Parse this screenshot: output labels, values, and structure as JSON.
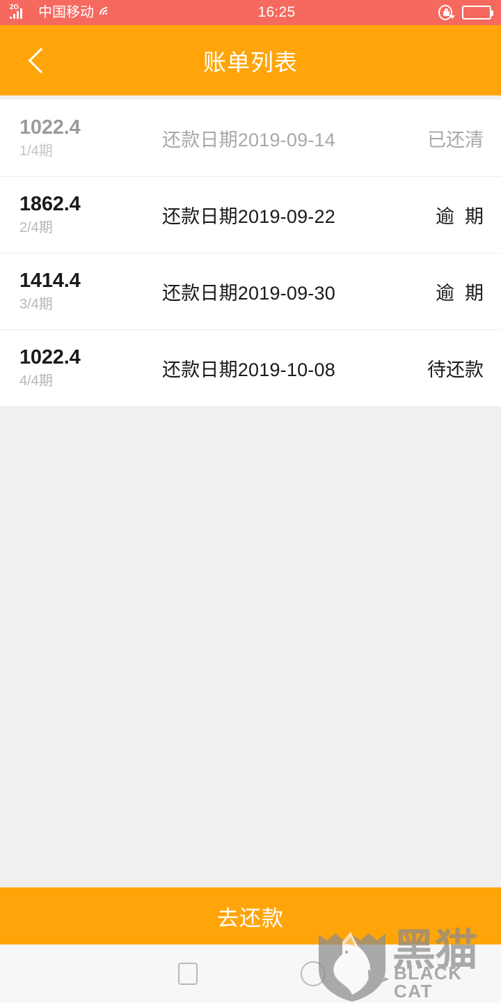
{
  "statusbar": {
    "network_type": "2G",
    "carrier": "中国移动",
    "time": "16:25",
    "signal_icon": "signal-bars-icon",
    "wifi_icon": "wifi-icon",
    "rotation_lock_icon": "rotation-lock-icon",
    "battery_icon": "battery-icon",
    "background_color": "#F5695F",
    "text_color": "#FFFFFF"
  },
  "header": {
    "back_icon": "chevron-left-icon",
    "title": "账单列表",
    "background_color": "#FFA50A",
    "text_color": "#FFFFFF"
  },
  "list": {
    "rows": [
      {
        "amount": "1022.4",
        "period": "1/4期",
        "date": "还款日期2019-09-14",
        "status": "已还清",
        "state": "paid"
      },
      {
        "amount": "1862.4",
        "period": "2/4期",
        "date": "还款日期2019-09-22",
        "status": "逾  期",
        "state": "overdue"
      },
      {
        "amount": "1414.4",
        "period": "3/4期",
        "date": "还款日期2019-09-30",
        "status": "逾  期",
        "state": "overdue"
      },
      {
        "amount": "1022.4",
        "period": "4/4期",
        "date": "还款日期2019-10-08",
        "status": "待还款",
        "state": "pending"
      }
    ]
  },
  "footer": {
    "pay_label": "去还款",
    "pay_background_color": "#FFA50A",
    "pay_text_color": "#FFFFFF"
  },
  "navbar": {
    "recents_icon": "square-recents-icon",
    "home_icon": "circle-home-icon",
    "background_color": "#F7F7F7"
  },
  "watermark": {
    "cat_icon": "black-cat-shield-logo",
    "text_cn": "黑猫",
    "text_en": "BLACK CAT",
    "color": "#8C8C8C"
  }
}
